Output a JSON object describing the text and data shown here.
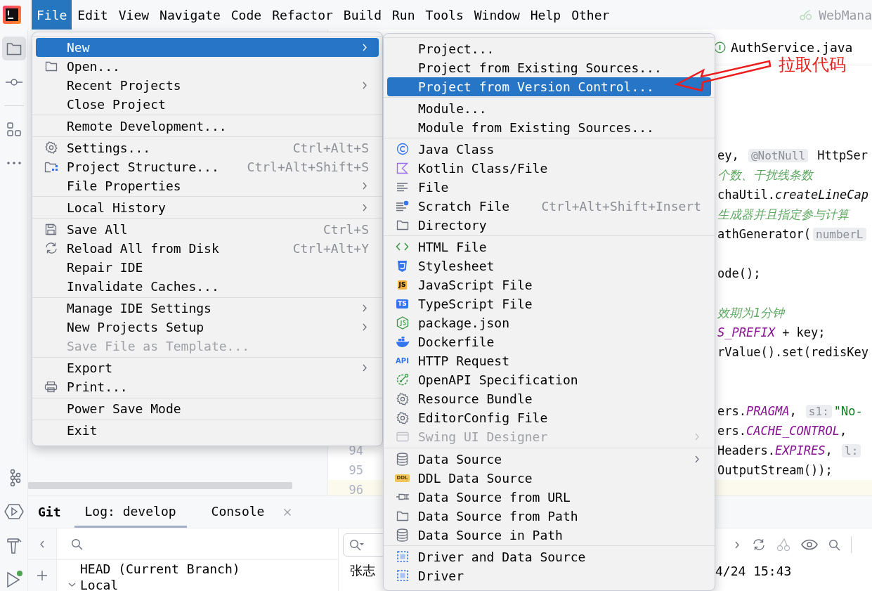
{
  "menu_bar": {
    "items": [
      {
        "label": "File",
        "selected": true
      },
      {
        "label": "Edit",
        "selected": false
      },
      {
        "label": "View",
        "selected": false
      },
      {
        "label": "Navigate",
        "selected": false
      },
      {
        "label": "Code",
        "selected": false
      },
      {
        "label": "Refactor",
        "selected": false
      },
      {
        "label": "Build",
        "selected": false
      },
      {
        "label": "Run",
        "selected": false
      },
      {
        "label": "Tools",
        "selected": false
      },
      {
        "label": "Window",
        "selected": false
      },
      {
        "label": "Help",
        "selected": false
      },
      {
        "label": "Other",
        "selected": false
      }
    ],
    "project_widget": {
      "label": "WebMana"
    }
  },
  "editor": {
    "tab": {
      "label": "AuthService.java"
    },
    "lines": [
      {
        "current": false,
        "segments": [
          {
            "kind": "plain",
            "text": "ey, "
          },
          {
            "kind": "hint",
            "text": "@NotNull"
          },
          {
            "kind": "plain",
            "text": " HttpSer"
          }
        ]
      },
      {
        "current": false,
        "segments": [
          {
            "kind": "comment",
            "text": "个数、干扰线条数"
          }
        ]
      },
      {
        "current": false,
        "segments": [
          {
            "kind": "plain",
            "text": "chaUtil."
          },
          {
            "kind": "static",
            "text": "createLineCap"
          }
        ]
      },
      {
        "current": false,
        "segments": [
          {
            "kind": "comment",
            "text": "生成器并且指定参与计算"
          }
        ]
      },
      {
        "current": false,
        "segments": [
          {
            "kind": "plain",
            "text": "athGenerator("
          },
          {
            "kind": "hint",
            "text": "numberL"
          }
        ]
      },
      {
        "current": false
      },
      {
        "current": false,
        "segments": [
          {
            "kind": "plain",
            "text": "ode();"
          }
        ]
      },
      {
        "current": false
      },
      {
        "current": false,
        "segments": [
          {
            "kind": "comment",
            "text": "效期为1分钟"
          }
        ]
      },
      {
        "current": false,
        "segments": [
          {
            "kind": "constant",
            "text": "S_PREFIX"
          },
          {
            "kind": "plain",
            "text": " + key;"
          }
        ]
      },
      {
        "current": false,
        "segments": [
          {
            "kind": "plain",
            "text": "rValue().set(redisKey"
          }
        ]
      },
      {
        "current": false
      },
      {
        "current": false
      },
      {
        "current": false,
        "segments": [
          {
            "kind": "plain",
            "text": "ers."
          },
          {
            "kind": "constant",
            "text": "PRAGMA"
          },
          {
            "kind": "plain",
            "text": ", "
          },
          {
            "kind": "hint",
            "text": "s1:"
          },
          {
            "kind": "string",
            "text": "\"No-"
          }
        ]
      },
      {
        "current": false,
        "segments": [
          {
            "kind": "plain",
            "text": "ers."
          },
          {
            "kind": "constant",
            "text": "CACHE_CONTROL"
          },
          {
            "kind": "plain",
            "text": ","
          }
        ]
      },
      {
        "current": false,
        "number": "94",
        "segments": [
          {
            "kind": "plain",
            "text": "Headers."
          },
          {
            "kind": "constant",
            "text": "EXPIRES"
          },
          {
            "kind": "plain",
            "text": ", "
          },
          {
            "kind": "hint",
            "text": "l:"
          }
        ]
      },
      {
        "current": false,
        "number": "95",
        "segments": [
          {
            "kind": "plain",
            "text": "OutputStream());"
          }
        ]
      },
      {
        "current": true,
        "number": "96"
      }
    ]
  },
  "bottom_panel": {
    "title": "Git",
    "tabs": [
      {
        "label": "Log: develop",
        "selected": true,
        "closable": false
      },
      {
        "label": "Console",
        "selected": false,
        "closable": true
      }
    ],
    "branch_tree": [
      {
        "kind": "leaf",
        "label": "HEAD (Current Branch)"
      },
      {
        "kind": "group",
        "label": "Local",
        "expanded": true
      }
    ],
    "commit_author": "张志",
    "commit_time": "4/24 15:43"
  },
  "file_menu": {
    "groups": [
      {
        "items": [
          {
            "label": "New",
            "selected": true,
            "disabled": false,
            "submenu": true
          },
          {
            "label": "Open...",
            "selected": false,
            "disabled": false,
            "submenu": false
          },
          {
            "label": "Recent Projects",
            "selected": false,
            "disabled": false,
            "submenu": true
          },
          {
            "label": "Close Project",
            "selected": false,
            "disabled": false,
            "submenu": false
          }
        ]
      },
      {
        "items": [
          {
            "label": "Remote Development...",
            "selected": false,
            "disabled": false,
            "submenu": false
          }
        ]
      },
      {
        "items": [
          {
            "label": "Settings...",
            "shortcut": "Ctrl+Alt+S",
            "selected": false,
            "disabled": false,
            "submenu": false
          },
          {
            "label": "Project Structure...",
            "shortcut": "Ctrl+Alt+Shift+S",
            "selected": false,
            "disabled": false,
            "submenu": false
          },
          {
            "label": "File Properties",
            "selected": false,
            "disabled": false,
            "submenu": true
          }
        ]
      },
      {
        "items": [
          {
            "label": "Local History",
            "selected": false,
            "disabled": false,
            "submenu": true
          }
        ]
      },
      {
        "items": [
          {
            "label": "Save All",
            "shortcut": "Ctrl+S",
            "selected": false,
            "disabled": false,
            "submenu": false
          },
          {
            "label": "Reload All from Disk",
            "shortcut": "Ctrl+Alt+Y",
            "selected": false,
            "disabled": false,
            "submenu": false
          },
          {
            "label": "Repair IDE",
            "selected": false,
            "disabled": false,
            "submenu": false
          },
          {
            "label": "Invalidate Caches...",
            "selected": false,
            "disabled": false,
            "submenu": false
          }
        ]
      },
      {
        "items": [
          {
            "label": "Manage IDE Settings",
            "selected": false,
            "disabled": false,
            "submenu": true
          },
          {
            "label": "New Projects Setup",
            "selected": false,
            "disabled": false,
            "submenu": true
          },
          {
            "label": "Save File as Template...",
            "selected": false,
            "disabled": true,
            "submenu": false
          }
        ]
      },
      {
        "items": [
          {
            "label": "Export",
            "selected": false,
            "disabled": false,
            "submenu": true
          },
          {
            "label": "Print...",
            "selected": false,
            "disabled": false,
            "submenu": false
          }
        ]
      },
      {
        "items": [
          {
            "label": "Power Save Mode",
            "selected": false,
            "disabled": false,
            "submenu": false
          }
        ]
      },
      {
        "items": [
          {
            "label": "Exit",
            "selected": false,
            "disabled": false,
            "submenu": false
          }
        ]
      }
    ]
  },
  "new_submenu": {
    "groups": [
      {
        "items": [
          {
            "label": "Project...",
            "selected": false,
            "disabled": false,
            "submenu": false
          },
          {
            "label": "Project from Existing Sources...",
            "selected": false,
            "disabled": false,
            "submenu": false
          },
          {
            "label": "Project from Version Control...",
            "selected": true,
            "disabled": false,
            "submenu": false
          }
        ]
      },
      {
        "items": [
          {
            "label": "Module...",
            "selected": false,
            "disabled": false,
            "submenu": false
          },
          {
            "label": "Module from Existing Sources...",
            "selected": false,
            "disabled": false,
            "submenu": false
          }
        ]
      },
      {
        "items": [
          {
            "label": "Java Class",
            "selected": false,
            "disabled": false,
            "submenu": false
          },
          {
            "label": "Kotlin Class/File",
            "selected": false,
            "disabled": false,
            "submenu": false
          },
          {
            "label": "File",
            "selected": false,
            "disabled": false,
            "submenu": false
          },
          {
            "label": "Scratch File",
            "shortcut": "Ctrl+Alt+Shift+Insert",
            "selected": false,
            "disabled": false,
            "submenu": false
          },
          {
            "label": "Directory",
            "selected": false,
            "disabled": false,
            "submenu": false
          }
        ]
      },
      {
        "items": [
          {
            "label": "HTML File",
            "selected": false,
            "disabled": false,
            "submenu": false
          },
          {
            "label": "Stylesheet",
            "selected": false,
            "disabled": false,
            "submenu": false
          },
          {
            "label": "JavaScript File",
            "badge": "JS",
            "selected": false,
            "disabled": false,
            "submenu": false
          },
          {
            "label": "TypeScript File",
            "badge": "TS",
            "selected": false,
            "disabled": false,
            "submenu": false
          },
          {
            "label": "package.json",
            "selected": false,
            "disabled": false,
            "submenu": false
          },
          {
            "label": "Dockerfile",
            "selected": false,
            "disabled": false,
            "submenu": false
          },
          {
            "label": "HTTP Request",
            "badge": "API",
            "selected": false,
            "disabled": false,
            "submenu": false
          },
          {
            "label": "OpenAPI Specification",
            "selected": false,
            "disabled": false,
            "submenu": false
          },
          {
            "label": "Resource Bundle",
            "selected": false,
            "disabled": false,
            "submenu": false
          },
          {
            "label": "EditorConfig File",
            "selected": false,
            "disabled": false,
            "submenu": false
          },
          {
            "label": "Swing UI Designer",
            "selected": false,
            "disabled": true,
            "submenu": true
          }
        ]
      },
      {
        "items": [
          {
            "label": "Data Source",
            "selected": false,
            "disabled": false,
            "submenu": true
          },
          {
            "label": "DDL Data Source",
            "badge": "DDL",
            "selected": false,
            "disabled": false,
            "submenu": false
          },
          {
            "label": "Data Source from URL",
            "selected": false,
            "disabled": false,
            "submenu": false
          },
          {
            "label": "Data Source from Path",
            "selected": false,
            "disabled": false,
            "submenu": false
          },
          {
            "label": "Data Source in Path",
            "selected": false,
            "disabled": false,
            "submenu": false
          }
        ]
      },
      {
        "items": [
          {
            "label": "Driver and Data Source",
            "selected": false,
            "disabled": false,
            "submenu": false
          },
          {
            "label": "Driver",
            "selected": false,
            "disabled": false,
            "submenu": false
          }
        ]
      }
    ]
  },
  "annotation": {
    "text": "拉取代码"
  }
}
